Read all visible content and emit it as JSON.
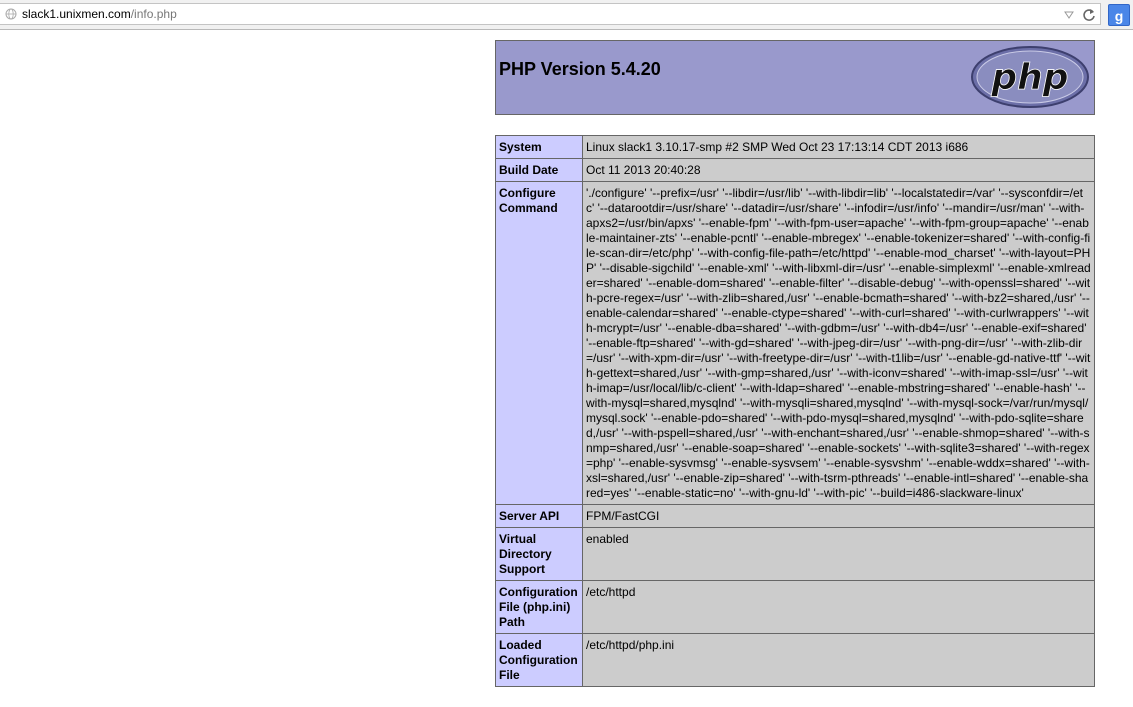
{
  "browser": {
    "url_host": "slack1.unixmen.com",
    "url_path": "/info.php",
    "search_button_label": "g"
  },
  "phpinfo": {
    "title": "PHP Version 5.4.20",
    "logo_text": "php",
    "rows": [
      {
        "label": "System",
        "value": "Linux slack1 3.10.17-smp #2 SMP Wed Oct 23 17:13:14 CDT 2013 i686"
      },
      {
        "label": "Build Date",
        "value": "Oct 11 2013 20:40:28"
      },
      {
        "label": "Configure Command",
        "value": "'./configure' '--prefix=/usr' '--libdir=/usr/lib' '--with-libdir=lib' '--localstatedir=/var' '--sysconfdir=/etc' '--datarootdir=/usr/share' '--datadir=/usr/share' '--infodir=/usr/info' '--mandir=/usr/man' '--with-apxs2=/usr/bin/apxs' '--enable-fpm' '--with-fpm-user=apache' '--with-fpm-group=apache' '--enable-maintainer-zts' '--enable-pcntl' '--enable-mbregex' '--enable-tokenizer=shared' '--with-config-file-scan-dir=/etc/php' '--with-config-file-path=/etc/httpd' '--enable-mod_charset' '--with-layout=PHP' '--disable-sigchild' '--enable-xml' '--with-libxml-dir=/usr' '--enable-simplexml' '--enable-xmlreader=shared' '--enable-dom=shared' '--enable-filter' '--disable-debug' '--with-openssl=shared' '--with-pcre-regex=/usr' '--with-zlib=shared,/usr' '--enable-bcmath=shared' '--with-bz2=shared,/usr' '--enable-calendar=shared' '--enable-ctype=shared' '--with-curl=shared' '--with-curlwrappers' '--with-mcrypt=/usr' '--enable-dba=shared' '--with-gdbm=/usr' '--with-db4=/usr' '--enable-exif=shared' '--enable-ftp=shared' '--with-gd=shared' '--with-jpeg-dir=/usr' '--with-png-dir=/usr' '--with-zlib-dir=/usr' '--with-xpm-dir=/usr' '--with-freetype-dir=/usr' '--with-t1lib=/usr' '--enable-gd-native-ttf' '--with-gettext=shared,/usr' '--with-gmp=shared,/usr' '--with-iconv=shared' '--with-imap-ssl=/usr' '--with-imap=/usr/local/lib/c-client' '--with-ldap=shared' '--enable-mbstring=shared' '--enable-hash' '--with-mysql=shared,mysqlnd' '--with-mysqli=shared,mysqlnd' '--with-mysql-sock=/var/run/mysql/mysql.sock' '--enable-pdo=shared' '--with-pdo-mysql=shared,mysqlnd' '--with-pdo-sqlite=shared,/usr' '--with-pspell=shared,/usr' '--with-enchant=shared,/usr' '--enable-shmop=shared' '--with-snmp=shared,/usr' '--enable-soap=shared' '--enable-sockets' '--with-sqlite3=shared' '--with-regex=php' '--enable-sysvmsg' '--enable-sysvsem' '--enable-sysvshm' '--enable-wddx=shared' '--with-xsl=shared,/usr' '--enable-zip=shared' '--with-tsrm-pthreads' '--enable-intl=shared' '--enable-shared=yes' '--enable-static=no' '--with-gnu-ld' '--with-pic' '--build=i486-slackware-linux'"
      },
      {
        "label": "Server API",
        "value": "FPM/FastCGI"
      },
      {
        "label": "Virtual Directory Support",
        "value": "enabled"
      },
      {
        "label": "Configuration File (php.ini) Path",
        "value": "/etc/httpd"
      },
      {
        "label": "Loaded Configuration File",
        "value": "/etc/httpd/php.ini"
      }
    ]
  },
  "colors": {
    "header_bg": "#9999cc",
    "label_bg": "#ccccff",
    "value_bg": "#cccccc",
    "border": "#666666"
  },
  "icons": [
    "globe-icon",
    "dropdown-icon",
    "reload-icon",
    "google-search-icon",
    "php-logo"
  ]
}
